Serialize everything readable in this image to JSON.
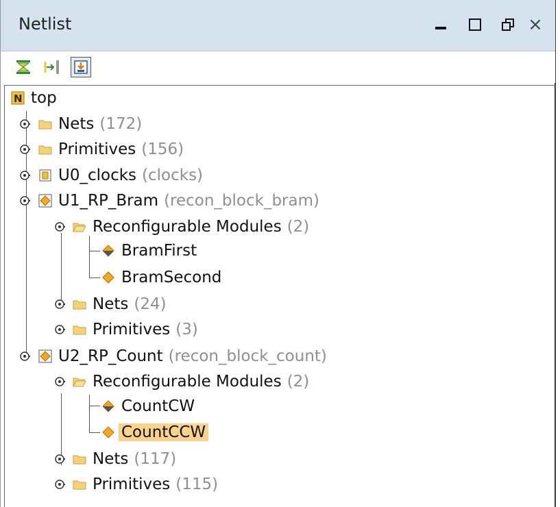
{
  "window": {
    "title": "Netlist",
    "controls": {
      "minimize_icon": "minimize-icon",
      "maximize_icon": "maximize-icon",
      "restore_icon": "restore-icon",
      "close_label": "×"
    }
  },
  "toolbar": {
    "buttons": [
      {
        "name": "collapse-all-icon"
      },
      {
        "name": "expand-all-icon"
      },
      {
        "name": "auto-fit-icon",
        "active": true
      }
    ]
  },
  "tree": {
    "root": {
      "label": "top",
      "icon": "netlist-root-icon"
    },
    "items": [
      {
        "label": "Nets",
        "meta": "(172)",
        "icon": "folder-icon"
      },
      {
        "label": "Primitives",
        "meta": "(156)",
        "icon": "folder-icon"
      },
      {
        "label": "U0_clocks",
        "meta": "(clocks)",
        "icon": "module-icon"
      },
      {
        "label": "U1_RP_Bram",
        "meta": "(recon_block_bram)",
        "icon": "reconfigurable-partition-icon"
      },
      {
        "label": "Reconfigurable Modules",
        "meta": "(2)",
        "icon": "open-folder-icon"
      },
      {
        "label": "BramFirst",
        "meta": "",
        "icon": "rm-active-icon"
      },
      {
        "label": "BramSecond",
        "meta": "",
        "icon": "rm-icon"
      },
      {
        "label": "Nets",
        "meta": "(24)",
        "icon": "folder-icon"
      },
      {
        "label": "Primitives",
        "meta": "(3)",
        "icon": "folder-icon"
      },
      {
        "label": "U2_RP_Count",
        "meta": "(recon_block_count)",
        "icon": "reconfigurable-partition-icon"
      },
      {
        "label": "Reconfigurable Modules",
        "meta": "(2)",
        "icon": "open-folder-icon"
      },
      {
        "label": "CountCW",
        "meta": "",
        "icon": "rm-active-icon"
      },
      {
        "label": "CountCCW",
        "meta": "",
        "icon": "rm-icon",
        "selected": true
      },
      {
        "label": "Nets",
        "meta": "(117)",
        "icon": "folder-icon"
      },
      {
        "label": "Primitives",
        "meta": "(115)",
        "icon": "folder-icon"
      }
    ]
  },
  "colors": {
    "titlebar": "#d6e3ee",
    "selection": "#f9d38b",
    "folder": "#f3d27a",
    "diamond": "#f5a623"
  }
}
